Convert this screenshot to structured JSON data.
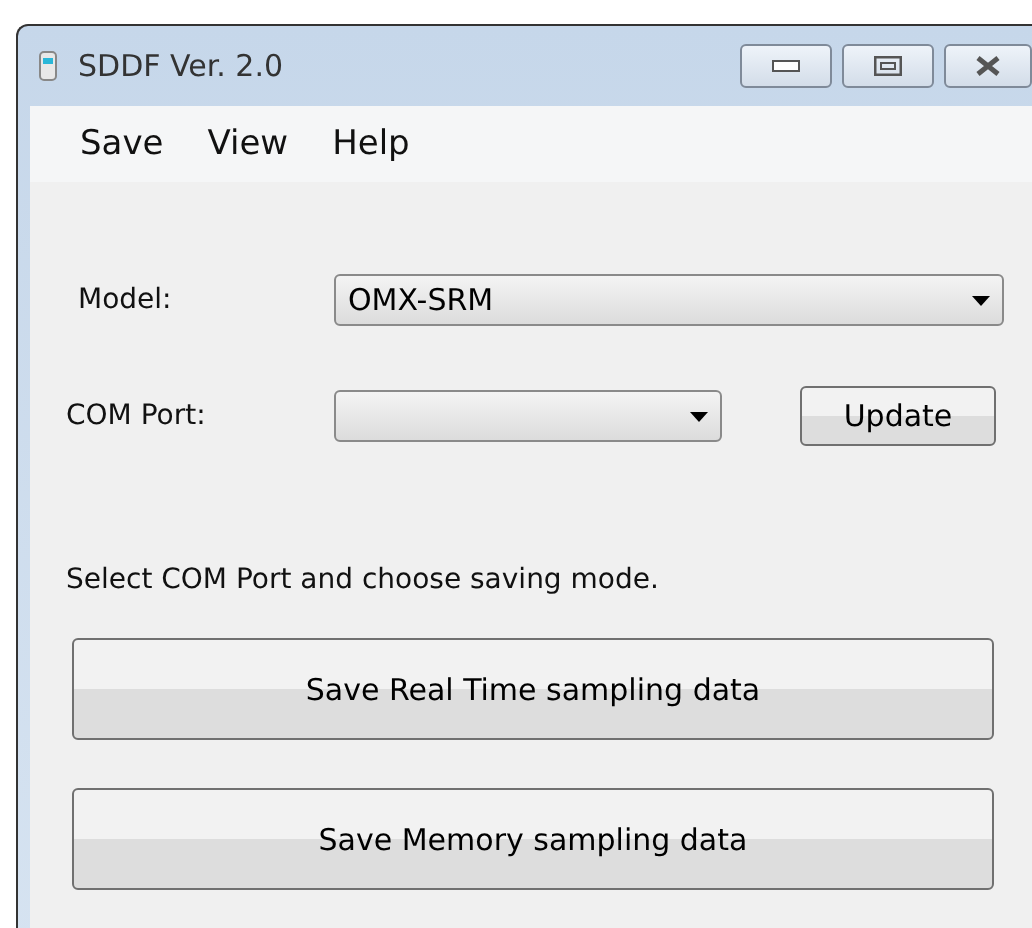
{
  "window": {
    "title": "SDDF Ver. 2.0"
  },
  "menu": [
    "Save",
    "View",
    "Help"
  ],
  "model": {
    "label": "Model:",
    "value": "OMX-SRM"
  },
  "com_port": {
    "label": "COM Port:",
    "update_button": "Update"
  },
  "instruction": "Select COM Port and choose saving mode.",
  "buttons": [
    "Save Real Time sampling data",
    "Save Memory sampling data"
  ]
}
